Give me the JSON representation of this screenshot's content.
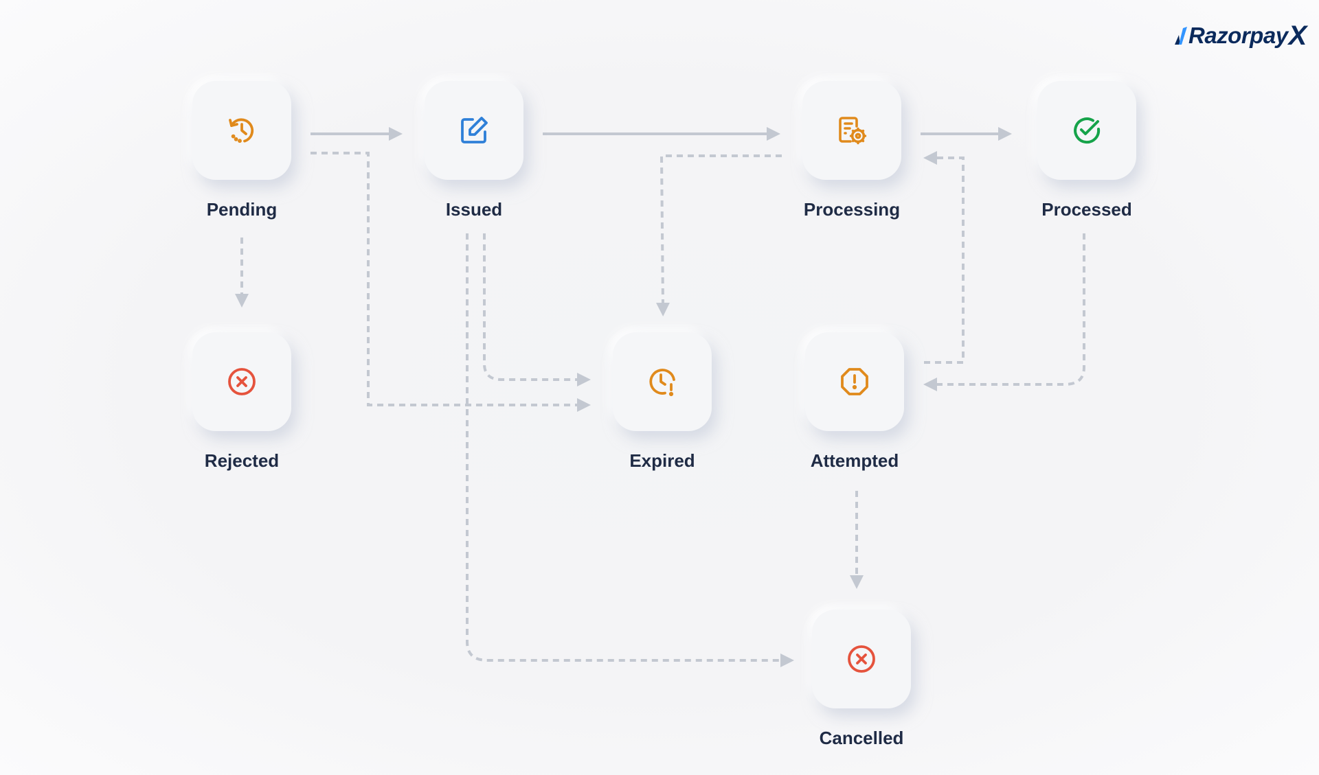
{
  "brand": {
    "name": "Razorpay",
    "suffix": "X",
    "colors": {
      "primary": "#0b2a5c",
      "accent_blue": "#3395ff",
      "accent_orange": "#f0842c"
    }
  },
  "colors": {
    "orange_icon": "#e08a1c",
    "blue_icon": "#2f80d8",
    "green_icon": "#16a34a",
    "red_icon": "#e5533d",
    "label": "#1f2b45",
    "connector": "#c3c8d1"
  },
  "nodes": [
    {
      "id": "pending",
      "label": "Pending",
      "icon": "history-icon",
      "color": "orange"
    },
    {
      "id": "issued",
      "label": "Issued",
      "icon": "edit-icon",
      "color": "blue"
    },
    {
      "id": "processing",
      "label": "Processing",
      "icon": "document-gear-icon",
      "color": "orange"
    },
    {
      "id": "processed",
      "label": "Processed",
      "icon": "check-circle-icon",
      "color": "green"
    },
    {
      "id": "rejected",
      "label": "Rejected",
      "icon": "x-circle-icon",
      "color": "red"
    },
    {
      "id": "expired",
      "label": "Expired",
      "icon": "clock-alert-icon",
      "color": "orange"
    },
    {
      "id": "attempted",
      "label": "Attempted",
      "icon": "octagon-alert-icon",
      "color": "orange"
    },
    {
      "id": "cancelled",
      "label": "Cancelled",
      "icon": "x-circle-icon",
      "color": "red"
    }
  ],
  "edges": [
    {
      "from": "pending",
      "to": "issued",
      "style": "solid"
    },
    {
      "from": "issued",
      "to": "processing",
      "style": "solid"
    },
    {
      "from": "processing",
      "to": "processed",
      "style": "solid"
    },
    {
      "from": "pending",
      "to": "rejected",
      "style": "dashed"
    },
    {
      "from": "pending",
      "to": "expired",
      "style": "dashed"
    },
    {
      "from": "issued",
      "to": "expired",
      "style": "dashed"
    },
    {
      "from": "issued",
      "to": "cancelled",
      "style": "dashed"
    },
    {
      "from": "processing",
      "to": "expired",
      "style": "dashed"
    },
    {
      "from": "attempted",
      "to": "processing",
      "style": "dashed"
    },
    {
      "from": "processed",
      "to": "attempted",
      "style": "dashed"
    },
    {
      "from": "attempted",
      "to": "cancelled",
      "style": "dashed"
    }
  ]
}
